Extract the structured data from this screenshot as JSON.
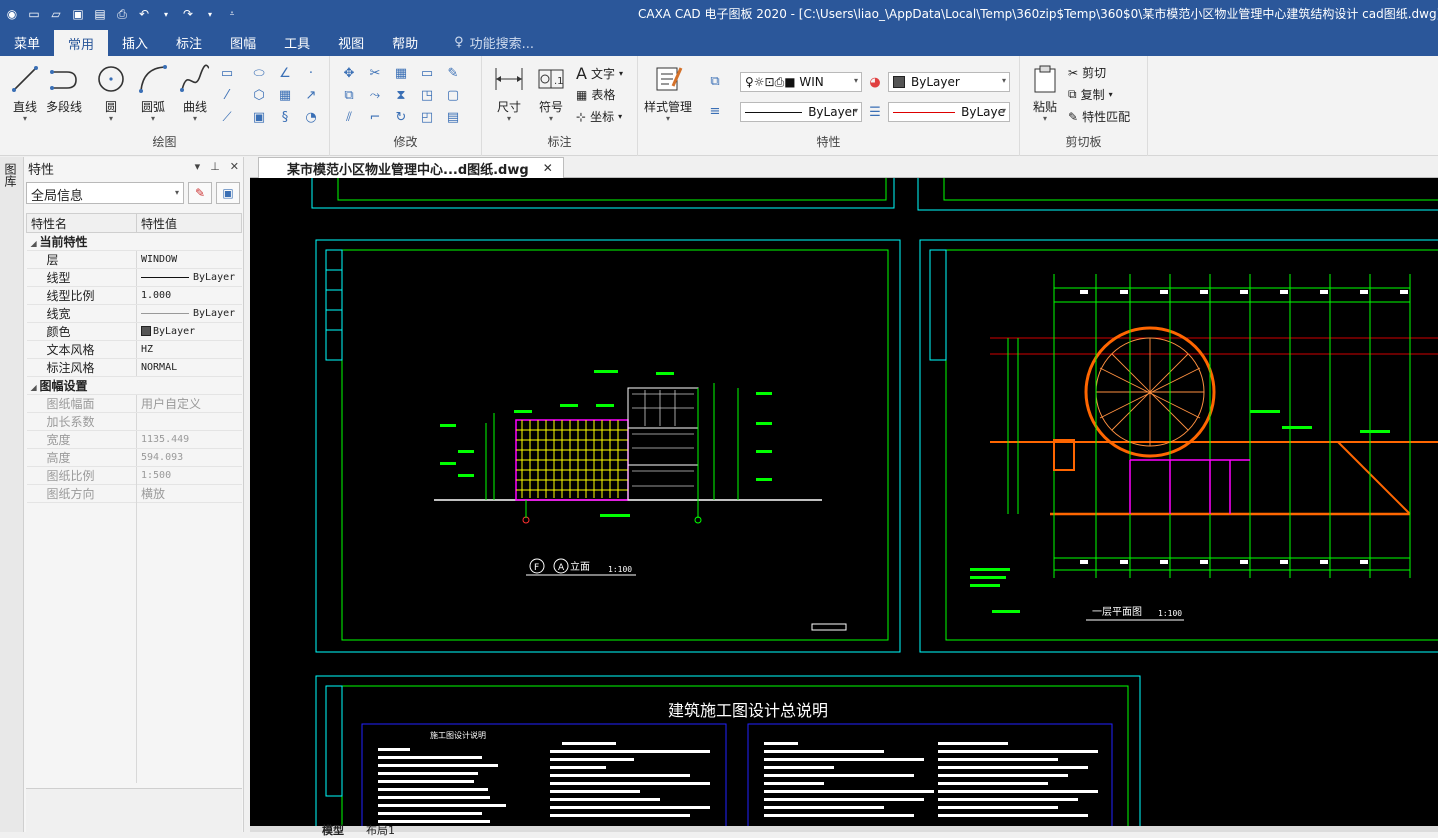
{
  "window": {
    "title": "CAXA CAD 电子图板 2020 - [C:\\Users\\liao_\\AppData\\Local\\Temp\\360zip$Temp\\360$0\\某市模范小区物业管理中心建筑结构设计 cad图纸.dwg]"
  },
  "tabs": [
    "菜单",
    "常用",
    "插入",
    "标注",
    "图幅",
    "工具",
    "视图",
    "帮助"
  ],
  "active_tab": "常用",
  "search_label": "功能搜索...",
  "ribbon": {
    "draw": {
      "label": "绘图",
      "line": "直线",
      "polyline": "多段线",
      "circle": "圆",
      "arc": "圆弧",
      "curve": "曲线"
    },
    "modify": {
      "label": "修改"
    },
    "annotate": {
      "label": "标注",
      "dimension": "尺寸",
      "symbol": "符号",
      "text": "文字",
      "table": "表格",
      "coordinate": "坐标"
    },
    "properties": {
      "label": "特性",
      "style_manager": "样式管理",
      "layer_combo": "WIN",
      "color_combo": "ByLayer",
      "linetype_combo": "ByLayer",
      "lineweight_combo": "ByLaye"
    },
    "clipboard": {
      "label": "剪切板",
      "paste": "粘贴",
      "cut": "剪切",
      "copy": "复制",
      "match": "特性匹配"
    }
  },
  "left_strip": {
    "tab": "图库"
  },
  "panel": {
    "title": "特性",
    "selector": "全局信息",
    "columns": [
      "特性名",
      "特性值"
    ],
    "sections": [
      {
        "name": "当前特性",
        "rows": [
          {
            "key": "层",
            "value": "WINDOW"
          },
          {
            "key": "线型",
            "value": "ByLayer"
          },
          {
            "key": "线型比例",
            "value": "1.000"
          },
          {
            "key": "线宽",
            "value": "ByLayer"
          },
          {
            "key": "颜色",
            "value": "ByLayer"
          },
          {
            "key": "文本风格",
            "value": "HZ"
          },
          {
            "key": "标注风格",
            "value": "NORMAL"
          }
        ]
      },
      {
        "name": "图幅设置",
        "rows": [
          {
            "key": "图纸幅面",
            "value": "用户自定义"
          },
          {
            "key": "加长系数",
            "value": ""
          },
          {
            "key": "宽度",
            "value": "1135.449"
          },
          {
            "key": "高度",
            "value": "594.093"
          },
          {
            "key": "图纸比例",
            "value": "1:500"
          },
          {
            "key": "图纸方向",
            "value": "横放"
          }
        ]
      }
    ]
  },
  "document_tab": {
    "label": "某市模范小区物业管理中心...d图纸.dwg"
  },
  "drawing": {
    "elevation_label": "立面",
    "elevation_axis_left": "F",
    "elevation_axis_right": "A",
    "elevation_scale": "1:100",
    "plan_label": "一层平面图",
    "plan_scale": "1:100",
    "notes_title": "建筑施工图设计总说明",
    "notes_subtitle": "施工图设计说明"
  },
  "layout_tabs": [
    "模型",
    "布局1"
  ],
  "colors": {
    "accent": "#2b579a",
    "canvas": "#000000",
    "frame": "#00ffff",
    "linework": "#00ff00"
  }
}
